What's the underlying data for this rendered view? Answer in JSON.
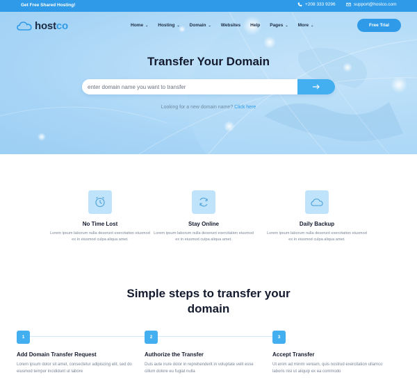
{
  "topbar": {
    "promo": "Get Free Shared Hosting!",
    "phone": "+208 333 9296",
    "email": "support@hostco.com"
  },
  "brand": {
    "name_dark": "host",
    "name_accent": "co"
  },
  "nav": {
    "items": [
      {
        "label": "Home",
        "has_caret": true
      },
      {
        "label": "Hosting",
        "has_caret": true
      },
      {
        "label": "Domain",
        "has_caret": true
      },
      {
        "label": "Websites",
        "has_caret": false
      },
      {
        "label": "Help",
        "has_caret": false
      },
      {
        "label": "Pages",
        "has_caret": true
      },
      {
        "label": "More",
        "has_caret": true
      }
    ],
    "cta": "Free Trial"
  },
  "hero": {
    "title": "Transfer Your Domain",
    "search_placeholder": "enter domain name you want to transfer",
    "sub_text": "Looking for a new domain name?",
    "sub_link": "Click here"
  },
  "features": [
    {
      "icon": "clock-icon",
      "title": "No Time Lost",
      "desc": "Lorem ipsum laborum nulla deserunt exercitation eiusmod ex in eiusmod culpa aliqua amet."
    },
    {
      "icon": "refresh-icon",
      "title": "Stay Online",
      "desc": "Lorem ipsum laborum nulla deserunt exercitation eiusmod ex in eiusmod culpa aliqua amet."
    },
    {
      "icon": "cloud-icon",
      "title": "Daily Backup",
      "desc": "Lorem ipsum laborum nulla deserunt exercitation eiusmod ex in eiusmod culpa aliqua amet."
    }
  ],
  "steps_section": {
    "title_line1": "Simple steps to transfer your",
    "title_line2": "domain",
    "steps": [
      {
        "num": "1",
        "title": "Add Domain Transfer Request",
        "desc": "Lorem ipsum dolor sit amet, consectetur adipiscing elit, sed do eiusmod tempor incididunt ut labore"
      },
      {
        "num": "2",
        "title": "Authorize the Transfer",
        "desc": "Duis aute irure dolor in reprehenderit in voluptate velit esse cillum dolore eu fugiat nulla"
      },
      {
        "num": "3",
        "title": "Accept Transfer",
        "desc": "Ut enim ad minim veniam, quis nostrud exercitation ullamco laboris nisi ut aliquip ex ea commodo"
      }
    ]
  },
  "colors": {
    "accent": "#2f9be8",
    "accent_light": "#43aef0",
    "icon_tile": "#bfe3fa",
    "heading": "#141a2e"
  }
}
